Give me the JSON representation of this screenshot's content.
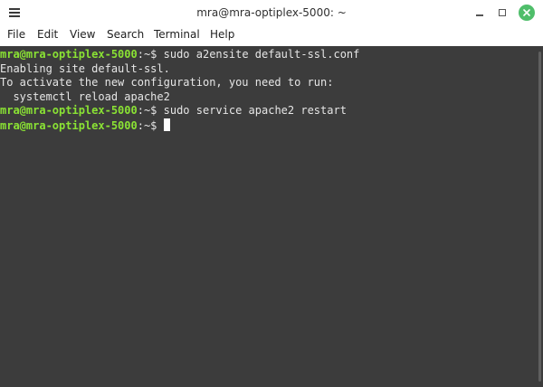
{
  "window": {
    "title": "mra@mra-optiplex-5000: ~"
  },
  "menu": {
    "items": [
      "File",
      "Edit",
      "View",
      "Search",
      "Terminal",
      "Help"
    ]
  },
  "terminal": {
    "prompt_user_host": "mra@mra-optiplex-5000",
    "prompt_suffix": ":~$ ",
    "lines": [
      {
        "type": "command",
        "text": "sudo a2ensite default-ssl.conf"
      },
      {
        "type": "output",
        "text": "Enabling site default-ssl."
      },
      {
        "type": "output",
        "text": "To activate the new configuration, you need to run:"
      },
      {
        "type": "output",
        "text": "  systemctl reload apache2"
      },
      {
        "type": "command",
        "text": "sudo service apache2 restart"
      },
      {
        "type": "command",
        "text": ""
      }
    ]
  },
  "colors": {
    "prompt": "#8ae234",
    "background": "#3c3c3c",
    "text": "#e6e6e6",
    "close_button": "#4fbe6a"
  },
  "icons": {
    "menu": "hamburger-icon",
    "minimize": "minimize-icon",
    "maximize": "maximize-icon",
    "close": "close-icon"
  }
}
